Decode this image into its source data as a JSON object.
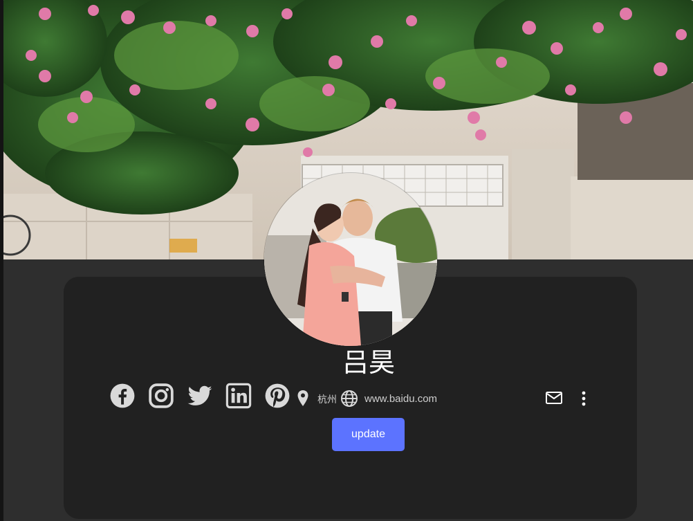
{
  "profile": {
    "name": "吕昊",
    "location": "杭州",
    "website": "www.baidu.com"
  },
  "actions": {
    "update_label": "update"
  },
  "social_links": [
    "facebook-icon",
    "instagram-icon",
    "twitter-icon",
    "linkedin-icon",
    "pinterest-icon"
  ],
  "colors": {
    "page_background": "#2e2e2e",
    "card_background": "#212121",
    "button_primary": "#5c73ff",
    "icon_color": "#d9d9d9",
    "text_color": "#ffffff"
  }
}
